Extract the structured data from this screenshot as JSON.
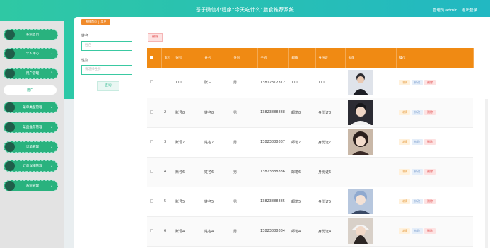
{
  "header": {
    "title": "基于微信小程序“今天吃什么”膳食推荐系统",
    "user_label": "管理员 admin",
    "logout_label": "退出登录"
  },
  "breadcrumb": {
    "home": "系统首页",
    "current": "用户"
  },
  "sidebar": {
    "items": [
      {
        "label": "系统首页"
      },
      {
        "label": "个人中心"
      },
      {
        "label": "用户管理"
      },
      {
        "label": "菜单类型管理"
      },
      {
        "label": "菜品推荐管理"
      },
      {
        "label": "订单管理"
      },
      {
        "label": "订单详细管理"
      },
      {
        "label": "系统管理"
      }
    ],
    "sub_item": "用户"
  },
  "filters": {
    "name_label": "姓名",
    "name_placeholder": "姓名",
    "gender_label": "性别",
    "gender_placeholder": "请选择性别",
    "search_label": "查询"
  },
  "toolbar": {
    "delete_label": "删除"
  },
  "table": {
    "columns": [
      "",
      "索引",
      "账号",
      "姓名",
      "性别",
      "手机",
      "邮箱",
      "身份证",
      "头像",
      "操作"
    ],
    "rows": [
      {
        "index": "1",
        "account": "111",
        "name": "张三",
        "gender": "男",
        "phone": "13812312312",
        "email": "111",
        "idcard": "111",
        "avatar": "avatar-1"
      },
      {
        "index": "2",
        "account": "账号8",
        "name": "姓名8",
        "gender": "男",
        "phone": "13823888888",
        "email": "邮箱8",
        "idcard": "身份证8",
        "avatar": "avatar-2"
      },
      {
        "index": "3",
        "account": "账号7",
        "name": "姓名7",
        "gender": "男",
        "phone": "13823888887",
        "email": "邮箱7",
        "idcard": "身份证7",
        "avatar": "avatar-3"
      },
      {
        "index": "4",
        "account": "账号6",
        "name": "姓名6",
        "gender": "男",
        "phone": "13823888886",
        "email": "邮箱6",
        "idcard": "身份证6",
        "avatar": "avatar-4"
      },
      {
        "index": "5",
        "account": "账号5",
        "name": "姓名5",
        "gender": "男",
        "phone": "13823888885",
        "email": "邮箱5",
        "idcard": "身份证5",
        "avatar": "avatar-5"
      },
      {
        "index": "6",
        "account": "账号4",
        "name": "姓名4",
        "gender": "男",
        "phone": "13823888884",
        "email": "邮箱4",
        "idcard": "身份证4",
        "avatar": "avatar-6"
      }
    ],
    "actions": {
      "detail": "详情",
      "edit": "修改",
      "delete": "删除"
    }
  },
  "colors": {
    "accent": "#2fc8a4",
    "header_row": "#f08a13",
    "danger": "#e04848"
  }
}
